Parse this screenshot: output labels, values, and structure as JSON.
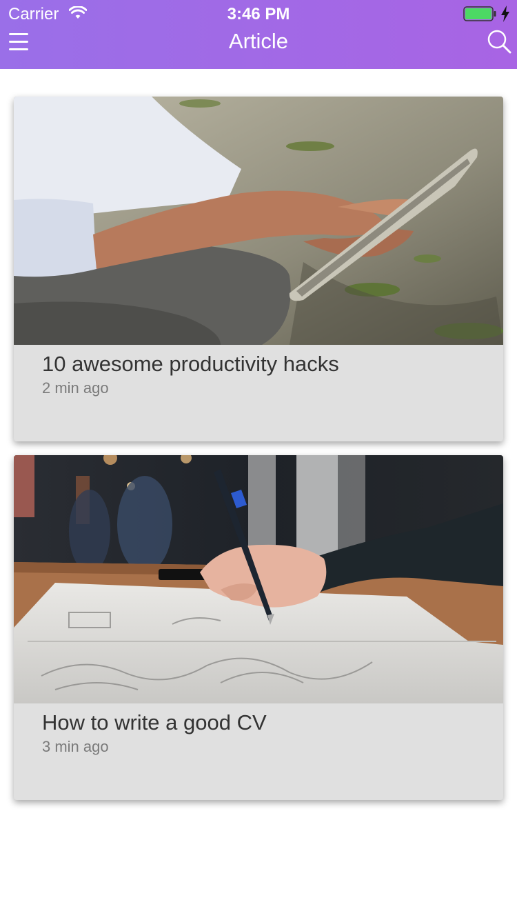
{
  "status_bar": {
    "carrier": "Carrier",
    "time": "3:46 PM",
    "wifi_icon": "wifi-icon",
    "battery_icon": "battery-icon",
    "charging_icon": "charging-bolt-icon",
    "battery_color": "#4cd964"
  },
  "header": {
    "title": "Article",
    "menu_icon": "hamburger-menu-icon",
    "search_icon": "search-icon",
    "gradient_start": "#9a6fe8",
    "gradient_end": "#a864e4"
  },
  "articles": [
    {
      "title": "10 awesome productivity hacks",
      "time": "2 min ago",
      "image": "man-holding-tablet-photo"
    },
    {
      "title": "How to write a good CV",
      "time": "3 min ago",
      "image": "hand-writing-with-pen-photo"
    }
  ]
}
